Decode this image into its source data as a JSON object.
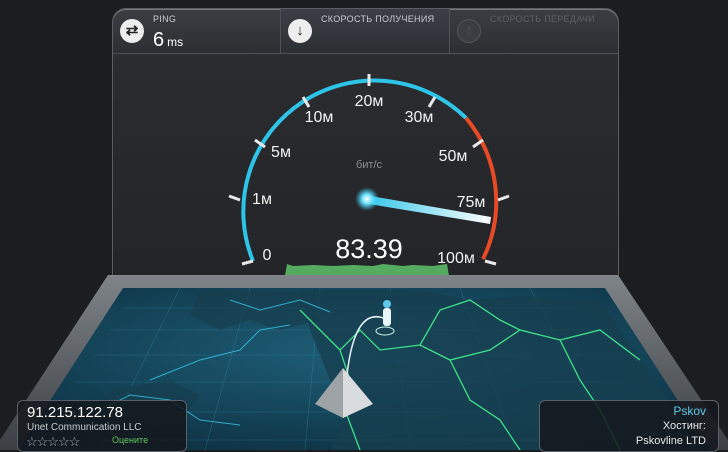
{
  "tabs": {
    "ping": {
      "label": "PING",
      "value": "6",
      "unit": "ms",
      "icon": "swap-arrows-icon"
    },
    "download": {
      "label": "СКОРОСТЬ ПОЛУЧЕНИЯ",
      "icon": "download-arrow-icon"
    },
    "upload": {
      "label": "СКОРОСТЬ ПЕРЕДАЧИ",
      "icon": "upload-arrow-icon"
    }
  },
  "gauge": {
    "unit_label": "бит/с",
    "value": "83.39",
    "ticks": [
      "0",
      "1м",
      "5м",
      "10м",
      "20м",
      "30м",
      "50м",
      "75м",
      "100м"
    ]
  },
  "client": {
    "ip": "91.215.122.78",
    "isp": "Unet Communication LLC",
    "rate_label": "Оцените"
  },
  "server": {
    "city": "Pskov",
    "host_label": "Хостинг:",
    "host_name": "Pskovline LTD"
  },
  "colors": {
    "accent": "#2ec4e8",
    "danger": "#e84a25",
    "progress": "#5ec46a"
  }
}
